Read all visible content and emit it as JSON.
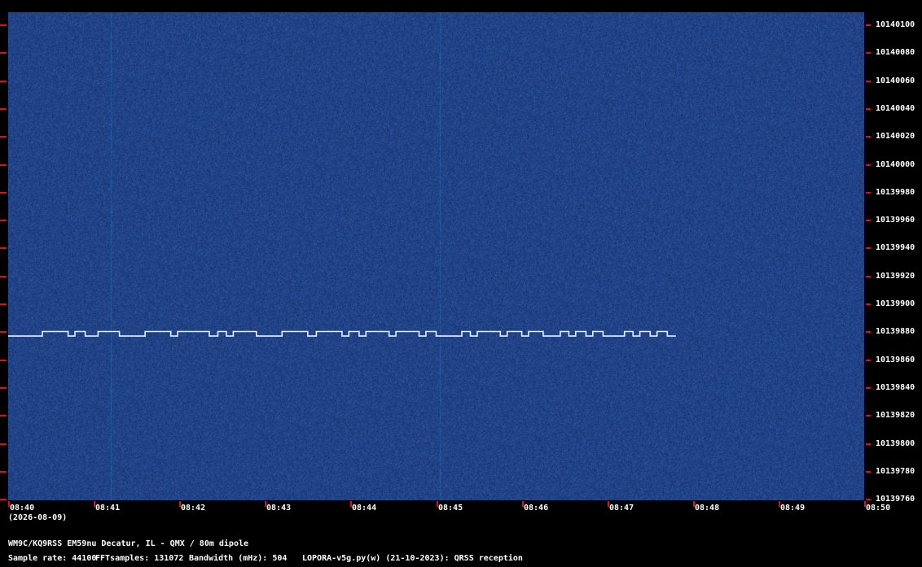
{
  "spectrogram": {
    "background_color": "#1b3c7c",
    "signal_color": "#e8f0ff",
    "tick_color": "#e01010",
    "frequency_labels": [
      "10140100",
      "10140080",
      "10140060",
      "10140040",
      "10140020",
      "10140000",
      "10139980",
      "10139960",
      "10139940",
      "10139920",
      "10139900",
      "10139880",
      "10139860",
      "10139840",
      "10139820",
      "10139800",
      "10139780",
      "10139760"
    ],
    "time_labels": [
      "08:40",
      "08:41",
      "08:42",
      "08:43",
      "08:44",
      "08:45",
      "08:46",
      "08:47",
      "08:48",
      "08:49",
      "08:50"
    ],
    "date_label": "(2026-08-09)",
    "signal": {
      "base_frequency_hz": 10139876.6,
      "shift_hz": 3.3,
      "start_time_min": 0.0,
      "end_time_min": 7.8
    }
  },
  "footer": {
    "station": "WM9C/KQ9RSS EM59nu Decatur, IL - QMX / 80m dipole",
    "sample_rate": "Sample rate: 44100",
    "fft_samples": "FFTsamples: 131072",
    "bandwidth": "Bandwidth (mHz): 504",
    "software": "LOPORA-v5g.py(w) (21-10-2023): QRSS reception"
  }
}
